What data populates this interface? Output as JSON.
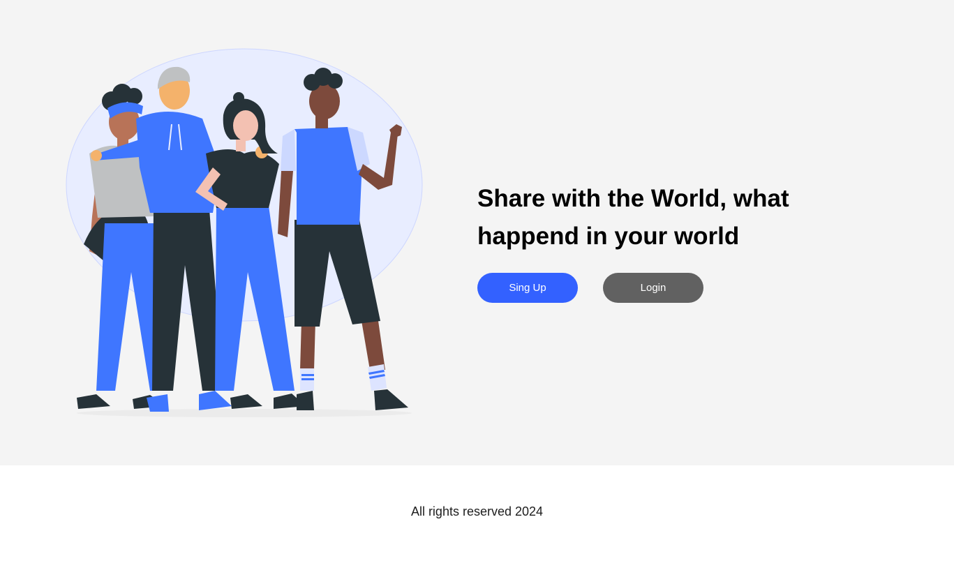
{
  "hero": {
    "illustration_name": "group-of-friends-illustration",
    "headline": "Share with the World, what happend in your world",
    "signup_label": "Sing Up",
    "login_label": "Login"
  },
  "footer": {
    "text": "All rights reserved 2024"
  },
  "colors": {
    "hero_background": "#f4f4f4",
    "blob": "#e8edff",
    "primary_button": "#3361ff",
    "secondary_button": "#616161",
    "clothing_blue": "#3f76ff",
    "dark": "#263238"
  }
}
